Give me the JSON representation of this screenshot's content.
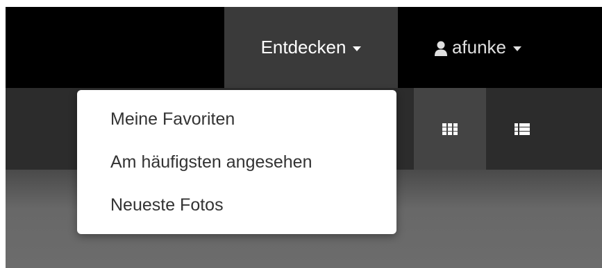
{
  "navbar": {
    "explore": {
      "label": "Entdecken",
      "icon": "caret-down-icon"
    },
    "user": {
      "label": "afunke",
      "icon": "user-icon",
      "caret": "caret-down-icon"
    }
  },
  "dropdown": {
    "items": [
      {
        "label": "Meine Favoriten"
      },
      {
        "label": "Am häufigsten angesehen"
      },
      {
        "label": "Neueste Fotos"
      }
    ]
  },
  "view_toggle": {
    "grid": {
      "icon": "grid-view-icon",
      "active": true
    },
    "list": {
      "icon": "list-view-icon",
      "active": false
    }
  },
  "colors": {
    "topbar": "#000000",
    "active_nav": "#3a3a3a",
    "subbar": "#2c2c2c",
    "active_view": "#444444",
    "dropdown_bg": "#ffffff",
    "dropdown_text": "#333333"
  }
}
